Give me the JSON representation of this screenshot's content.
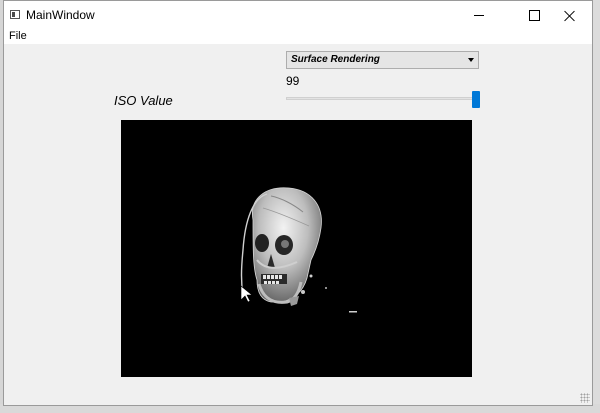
{
  "window": {
    "title": "MainWindow",
    "minimize_icon": "minimize-icon",
    "maximize_icon": "maximize-icon",
    "close_icon": "close-icon"
  },
  "menubar": {
    "items": [
      {
        "label": "File"
      }
    ]
  },
  "controls": {
    "render_mode": {
      "selected": "Surface Rendering",
      "icon": "chevron-down-icon"
    },
    "iso": {
      "label": "ISO Value",
      "value_text": "99",
      "slider_position_fraction": 1.0
    }
  },
  "viewport": {
    "background": "#000000",
    "content": "skull-render"
  },
  "colors": {
    "accent": "#0078d7",
    "window_bg": "#f0f0f0"
  }
}
